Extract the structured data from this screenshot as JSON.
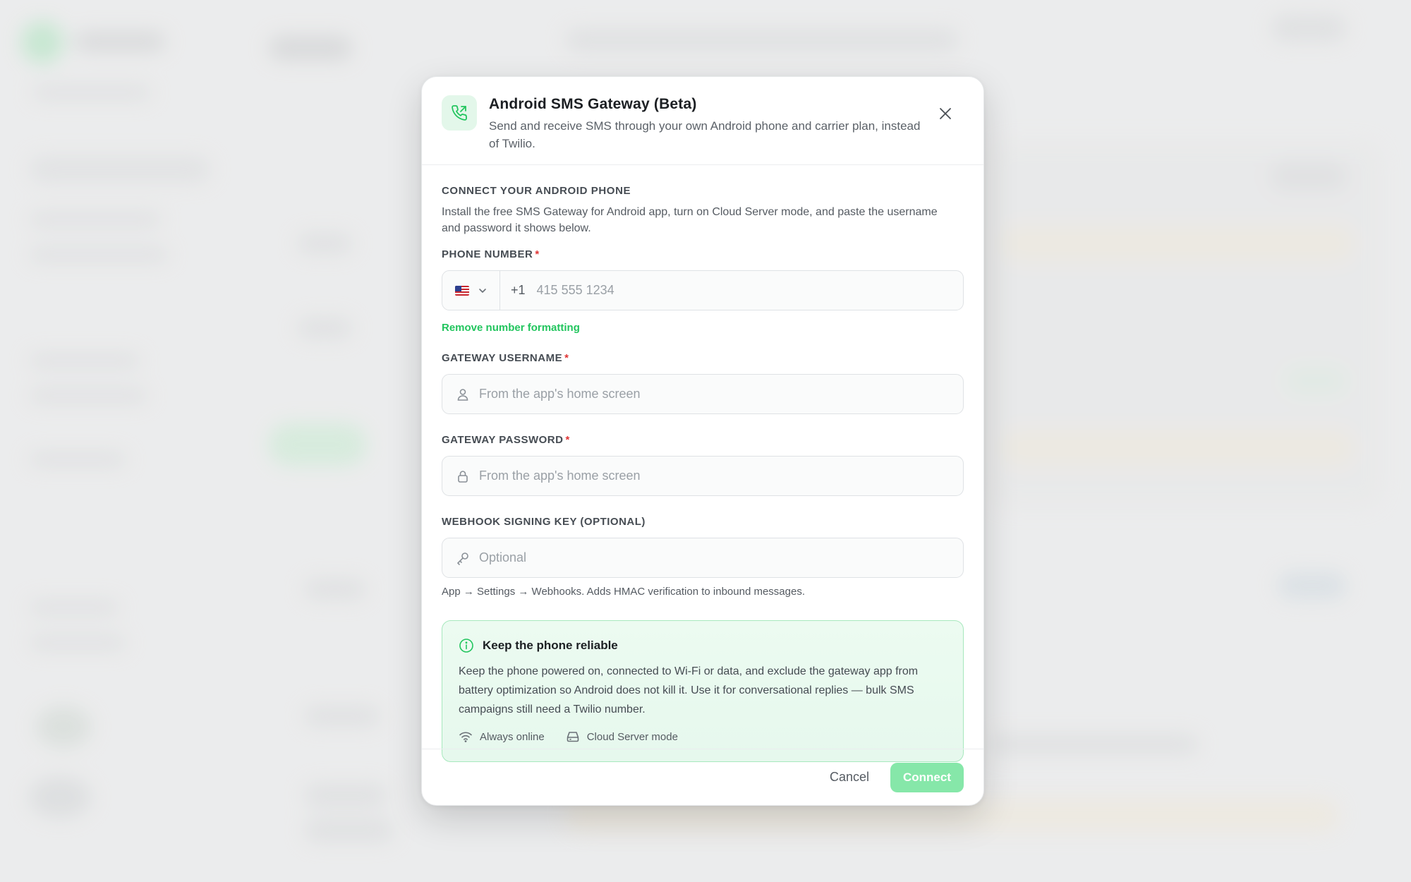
{
  "dialog": {
    "title": "Android SMS Gateway (Beta)",
    "subtitle": "Send and receive SMS through your own Android phone and carrier plan, instead of Twilio.",
    "header_icon": "phone-outgoing-icon",
    "close_icon": "close-icon"
  },
  "section": {
    "title": "CONNECT YOUR ANDROID PHONE",
    "description": "Install the free SMS Gateway for Android app, turn on Cloud Server mode, and paste the username and password it shows below."
  },
  "phone": {
    "label": "PHONE NUMBER",
    "required_mark": "*",
    "country_flag": "us-flag",
    "dial_code": "+1",
    "value": "",
    "placeholder": "415 555 1234",
    "format_link": "Remove number formatting"
  },
  "username": {
    "label": "GATEWAY USERNAME",
    "required_mark": "*",
    "icon": "user-icon",
    "value": "",
    "placeholder": "From the app's home screen"
  },
  "password": {
    "label": "GATEWAY PASSWORD",
    "required_mark": "*",
    "icon": "lock-icon",
    "value": "",
    "placeholder": "From the app's home screen"
  },
  "webhook": {
    "label": "WEBHOOK SIGNING KEY (OPTIONAL)",
    "icon": "key-icon",
    "value": "",
    "placeholder": "Optional",
    "hint": "App → Settings → Webhooks. Adds HMAC verification to inbound messages."
  },
  "callout": {
    "icon": "info-icon",
    "title": "Keep the phone reliable",
    "text": "Keep the phone powered on, connected to Wi-Fi or data, and exclude the gateway app from battery optimization so Android does not kill it. Use it for conversational replies — bulk SMS campaigns still need a Twilio number.",
    "tags": [
      {
        "icon": "wifi-icon",
        "label": "Always online"
      },
      {
        "icon": "server-icon",
        "label": "Cloud Server mode"
      }
    ]
  },
  "footer": {
    "cancel_label": "Cancel",
    "connect_label": "Connect"
  },
  "colors": {
    "accent": "#22c55e",
    "accent_disabled": "#86e7a9",
    "callout_bg": "#ecfbf1",
    "required": "#e03535"
  }
}
